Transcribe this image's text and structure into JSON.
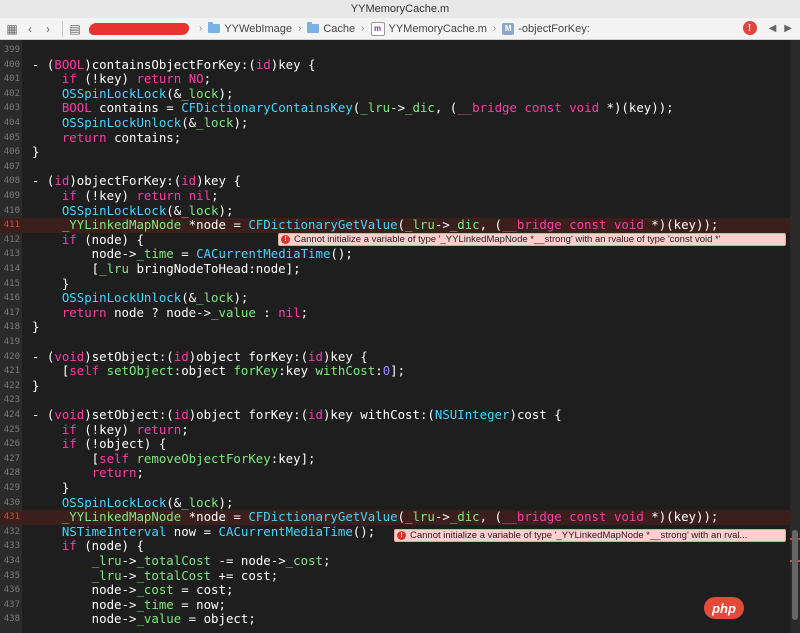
{
  "window": {
    "title": "YYMemoryCache.m"
  },
  "jumpbar": {
    "crumbs": [
      "YYWebImage",
      "Cache",
      "YYMemoryCache.m",
      "-objectForKey:"
    ],
    "method_badge": "M",
    "file_badge": "m"
  },
  "errors": {
    "line411": "Cannot initialize a variable of type '_YYLinkedMapNode *__strong' with an rvalue of type 'const void *'",
    "line432": "Cannot initialize a variable of type '_YYLinkedMapNode *__strong' with an rval..."
  },
  "watermark": "php",
  "code": [
    {
      "n": "399",
      "t": []
    },
    {
      "n": "400",
      "t": [
        [
          "- (",
          "id"
        ],
        [
          "BOOL",
          "kw"
        ],
        [
          ")containsObjectForKey:(",
          "id"
        ],
        [
          "id",
          "kw"
        ],
        [
          ")key {",
          "id"
        ]
      ]
    },
    {
      "n": "401",
      "t": [
        [
          "    ",
          "id"
        ],
        [
          "if",
          "kw"
        ],
        [
          " (!key) ",
          "id"
        ],
        [
          "return",
          "kw"
        ],
        [
          " ",
          "id"
        ],
        [
          "NO",
          "kw"
        ],
        [
          ";",
          "id"
        ]
      ]
    },
    {
      "n": "402",
      "t": [
        [
          "    ",
          "id"
        ],
        [
          "OSSpinLockLock",
          "ty"
        ],
        [
          "(&",
          "id"
        ],
        [
          "_lock",
          "gr"
        ],
        [
          ");",
          "id"
        ]
      ]
    },
    {
      "n": "403",
      "t": [
        [
          "    ",
          "id"
        ],
        [
          "BOOL",
          "kw"
        ],
        [
          " contains = ",
          "id"
        ],
        [
          "CFDictionaryContainsKey",
          "ty"
        ],
        [
          "(",
          "id"
        ],
        [
          "_lru",
          "gr"
        ],
        [
          "->",
          "id"
        ],
        [
          "_dic",
          "gr"
        ],
        [
          ", (",
          "id"
        ],
        [
          "__bridge",
          "kw"
        ],
        [
          " ",
          "id"
        ],
        [
          "const",
          "kw"
        ],
        [
          " ",
          "id"
        ],
        [
          "void",
          "kw"
        ],
        [
          " *)(key));",
          "id"
        ]
      ]
    },
    {
      "n": "404",
      "t": [
        [
          "    ",
          "id"
        ],
        [
          "OSSpinLockUnlock",
          "ty"
        ],
        [
          "(&",
          "id"
        ],
        [
          "_lock",
          "gr"
        ],
        [
          ");",
          "id"
        ]
      ]
    },
    {
      "n": "405",
      "t": [
        [
          "    ",
          "id"
        ],
        [
          "return",
          "kw"
        ],
        [
          " contains;",
          "id"
        ]
      ]
    },
    {
      "n": "406",
      "t": [
        [
          "}",
          "id"
        ]
      ]
    },
    {
      "n": "407",
      "t": []
    },
    {
      "n": "408",
      "t": [
        [
          "- (",
          "id"
        ],
        [
          "id",
          "kw"
        ],
        [
          ")objectForKey:(",
          "id"
        ],
        [
          "id",
          "kw"
        ],
        [
          ")key {",
          "id"
        ]
      ]
    },
    {
      "n": "409",
      "t": [
        [
          "    ",
          "id"
        ],
        [
          "if",
          "kw"
        ],
        [
          " (!key) ",
          "id"
        ],
        [
          "return",
          "kw"
        ],
        [
          " ",
          "id"
        ],
        [
          "nil",
          "kw"
        ],
        [
          ";",
          "id"
        ]
      ]
    },
    {
      "n": "410",
      "t": [
        [
          "    ",
          "id"
        ],
        [
          "OSSpinLockLock",
          "ty"
        ],
        [
          "(&",
          "id"
        ],
        [
          "_lock",
          "gr"
        ],
        [
          ");",
          "id"
        ]
      ]
    },
    {
      "n": "411",
      "err": true,
      "t": [
        [
          "    ",
          "id"
        ],
        [
          "_YYLinkedMapNode",
          "gr"
        ],
        [
          " *node = ",
          "id"
        ],
        [
          "CFDictionaryGetValue",
          "ty"
        ],
        [
          "(",
          "id"
        ],
        [
          "_lru",
          "gr"
        ],
        [
          "->",
          "id"
        ],
        [
          "_dic",
          "gr"
        ],
        [
          ", (",
          "id"
        ],
        [
          "__bridge",
          "kw"
        ],
        [
          " ",
          "id"
        ],
        [
          "const",
          "kw"
        ],
        [
          " ",
          "id"
        ],
        [
          "void",
          "kw"
        ],
        [
          " *)(key));",
          "id"
        ]
      ]
    },
    {
      "n": "412",
      "t": [
        [
          "    ",
          "id"
        ],
        [
          "if",
          "kw"
        ],
        [
          " (node) {",
          "id"
        ]
      ]
    },
    {
      "n": "413",
      "t": [
        [
          "        node->",
          "id"
        ],
        [
          "_time",
          "gr"
        ],
        [
          " = ",
          "id"
        ],
        [
          "CACurrentMediaTime",
          "ty"
        ],
        [
          "();",
          "id"
        ]
      ]
    },
    {
      "n": "414",
      "t": [
        [
          "        [",
          "id"
        ],
        [
          "_lru",
          "gr"
        ],
        [
          " bringNodeToHead:node];",
          "id"
        ]
      ]
    },
    {
      "n": "415",
      "t": [
        [
          "    }",
          "id"
        ]
      ]
    },
    {
      "n": "416",
      "t": [
        [
          "    ",
          "id"
        ],
        [
          "OSSpinLockUnlock",
          "ty"
        ],
        [
          "(&",
          "id"
        ],
        [
          "_lock",
          "gr"
        ],
        [
          ");",
          "id"
        ]
      ]
    },
    {
      "n": "417",
      "t": [
        [
          "    ",
          "id"
        ],
        [
          "return",
          "kw"
        ],
        [
          " node ? node->",
          "id"
        ],
        [
          "_value",
          "gr"
        ],
        [
          " : ",
          "id"
        ],
        [
          "nil",
          "kw"
        ],
        [
          ";",
          "id"
        ]
      ]
    },
    {
      "n": "418",
      "t": [
        [
          "}",
          "id"
        ]
      ]
    },
    {
      "n": "419",
      "t": []
    },
    {
      "n": "420",
      "t": [
        [
          "- (",
          "id"
        ],
        [
          "void",
          "kw"
        ],
        [
          ")setObject:(",
          "id"
        ],
        [
          "id",
          "kw"
        ],
        [
          ")object forKey:(",
          "id"
        ],
        [
          "id",
          "kw"
        ],
        [
          ")key {",
          "id"
        ]
      ]
    },
    {
      "n": "421",
      "t": [
        [
          "    [",
          "id"
        ],
        [
          "self",
          "kw"
        ],
        [
          " ",
          "id"
        ],
        [
          "setObject",
          "gr"
        ],
        [
          ":object ",
          "id"
        ],
        [
          "forKey",
          "gr"
        ],
        [
          ":key ",
          "id"
        ],
        [
          "withCost",
          "gr"
        ],
        [
          ":",
          "id"
        ],
        [
          "0",
          "num"
        ],
        [
          "];",
          "id"
        ]
      ]
    },
    {
      "n": "422",
      "t": [
        [
          "}",
          "id"
        ]
      ]
    },
    {
      "n": "423",
      "t": []
    },
    {
      "n": "424",
      "t": [
        [
          "- (",
          "id"
        ],
        [
          "void",
          "kw"
        ],
        [
          ")setObject:(",
          "id"
        ],
        [
          "id",
          "kw"
        ],
        [
          ")object forKey:(",
          "id"
        ],
        [
          "id",
          "kw"
        ],
        [
          ")key withCost:(",
          "id"
        ],
        [
          "NSUInteger",
          "ty"
        ],
        [
          ")cost {",
          "id"
        ]
      ]
    },
    {
      "n": "425",
      "t": [
        [
          "    ",
          "id"
        ],
        [
          "if",
          "kw"
        ],
        [
          " (!key) ",
          "id"
        ],
        [
          "return",
          "kw"
        ],
        [
          ";",
          "id"
        ]
      ]
    },
    {
      "n": "426",
      "t": [
        [
          "    ",
          "id"
        ],
        [
          "if",
          "kw"
        ],
        [
          " (!object) {",
          "id"
        ]
      ]
    },
    {
      "n": "427",
      "t": [
        [
          "        [",
          "id"
        ],
        [
          "self",
          "kw"
        ],
        [
          " ",
          "id"
        ],
        [
          "removeObjectForKey",
          "gr"
        ],
        [
          ":key];",
          "id"
        ]
      ]
    },
    {
      "n": "428",
      "t": [
        [
          "        ",
          "id"
        ],
        [
          "return",
          "kw"
        ],
        [
          ";",
          "id"
        ]
      ]
    },
    {
      "n": "429",
      "t": [
        [
          "    }",
          "id"
        ]
      ]
    },
    {
      "n": "430",
      "t": [
        [
          "    ",
          "id"
        ],
        [
          "OSSpinLockLock",
          "ty"
        ],
        [
          "(&",
          "id"
        ],
        [
          "_lock",
          "gr"
        ],
        [
          ");",
          "id"
        ]
      ]
    },
    {
      "n": "431",
      "err": true,
      "t": [
        [
          "    ",
          "id"
        ],
        [
          "_YYLinkedMapNode",
          "gr"
        ],
        [
          " *node = ",
          "id"
        ],
        [
          "CFDictionaryGetValue",
          "ty"
        ],
        [
          "(",
          "id"
        ],
        [
          "_lru",
          "gr"
        ],
        [
          "->",
          "id"
        ],
        [
          "_dic",
          "gr"
        ],
        [
          ", (",
          "id"
        ],
        [
          "__bridge",
          "kw"
        ],
        [
          " ",
          "id"
        ],
        [
          "const",
          "kw"
        ],
        [
          " ",
          "id"
        ],
        [
          "void",
          "kw"
        ],
        [
          " *)(key));",
          "id"
        ]
      ]
    },
    {
      "n": "432",
      "t": [
        [
          "    ",
          "id"
        ],
        [
          "NSTimeInterval",
          "ty"
        ],
        [
          " now = ",
          "id"
        ],
        [
          "CACurrentMediaTime",
          "ty"
        ],
        [
          "();",
          "id"
        ]
      ]
    },
    {
      "n": "433",
      "t": [
        [
          "    ",
          "id"
        ],
        [
          "if",
          "kw"
        ],
        [
          " (node) {",
          "id"
        ]
      ]
    },
    {
      "n": "434",
      "t": [
        [
          "        ",
          "id"
        ],
        [
          "_lru",
          "gr"
        ],
        [
          "->",
          "id"
        ],
        [
          "_totalCost",
          "gr"
        ],
        [
          " -= node->",
          "id"
        ],
        [
          "_cost",
          "gr"
        ],
        [
          ";",
          "id"
        ]
      ]
    },
    {
      "n": "435",
      "t": [
        [
          "        ",
          "id"
        ],
        [
          "_lru",
          "gr"
        ],
        [
          "->",
          "id"
        ],
        [
          "_totalCost",
          "gr"
        ],
        [
          " += cost;",
          "id"
        ]
      ]
    },
    {
      "n": "436",
      "t": [
        [
          "        node->",
          "id"
        ],
        [
          "_cost",
          "gr"
        ],
        [
          " = cost;",
          "id"
        ]
      ]
    },
    {
      "n": "437",
      "t": [
        [
          "        node->",
          "id"
        ],
        [
          "_time",
          "gr"
        ],
        [
          " = now;",
          "id"
        ]
      ]
    },
    {
      "n": "438",
      "t": [
        [
          "        node->",
          "id"
        ],
        [
          "_value",
          "gr"
        ],
        [
          " = object;",
          "id"
        ]
      ]
    }
  ]
}
